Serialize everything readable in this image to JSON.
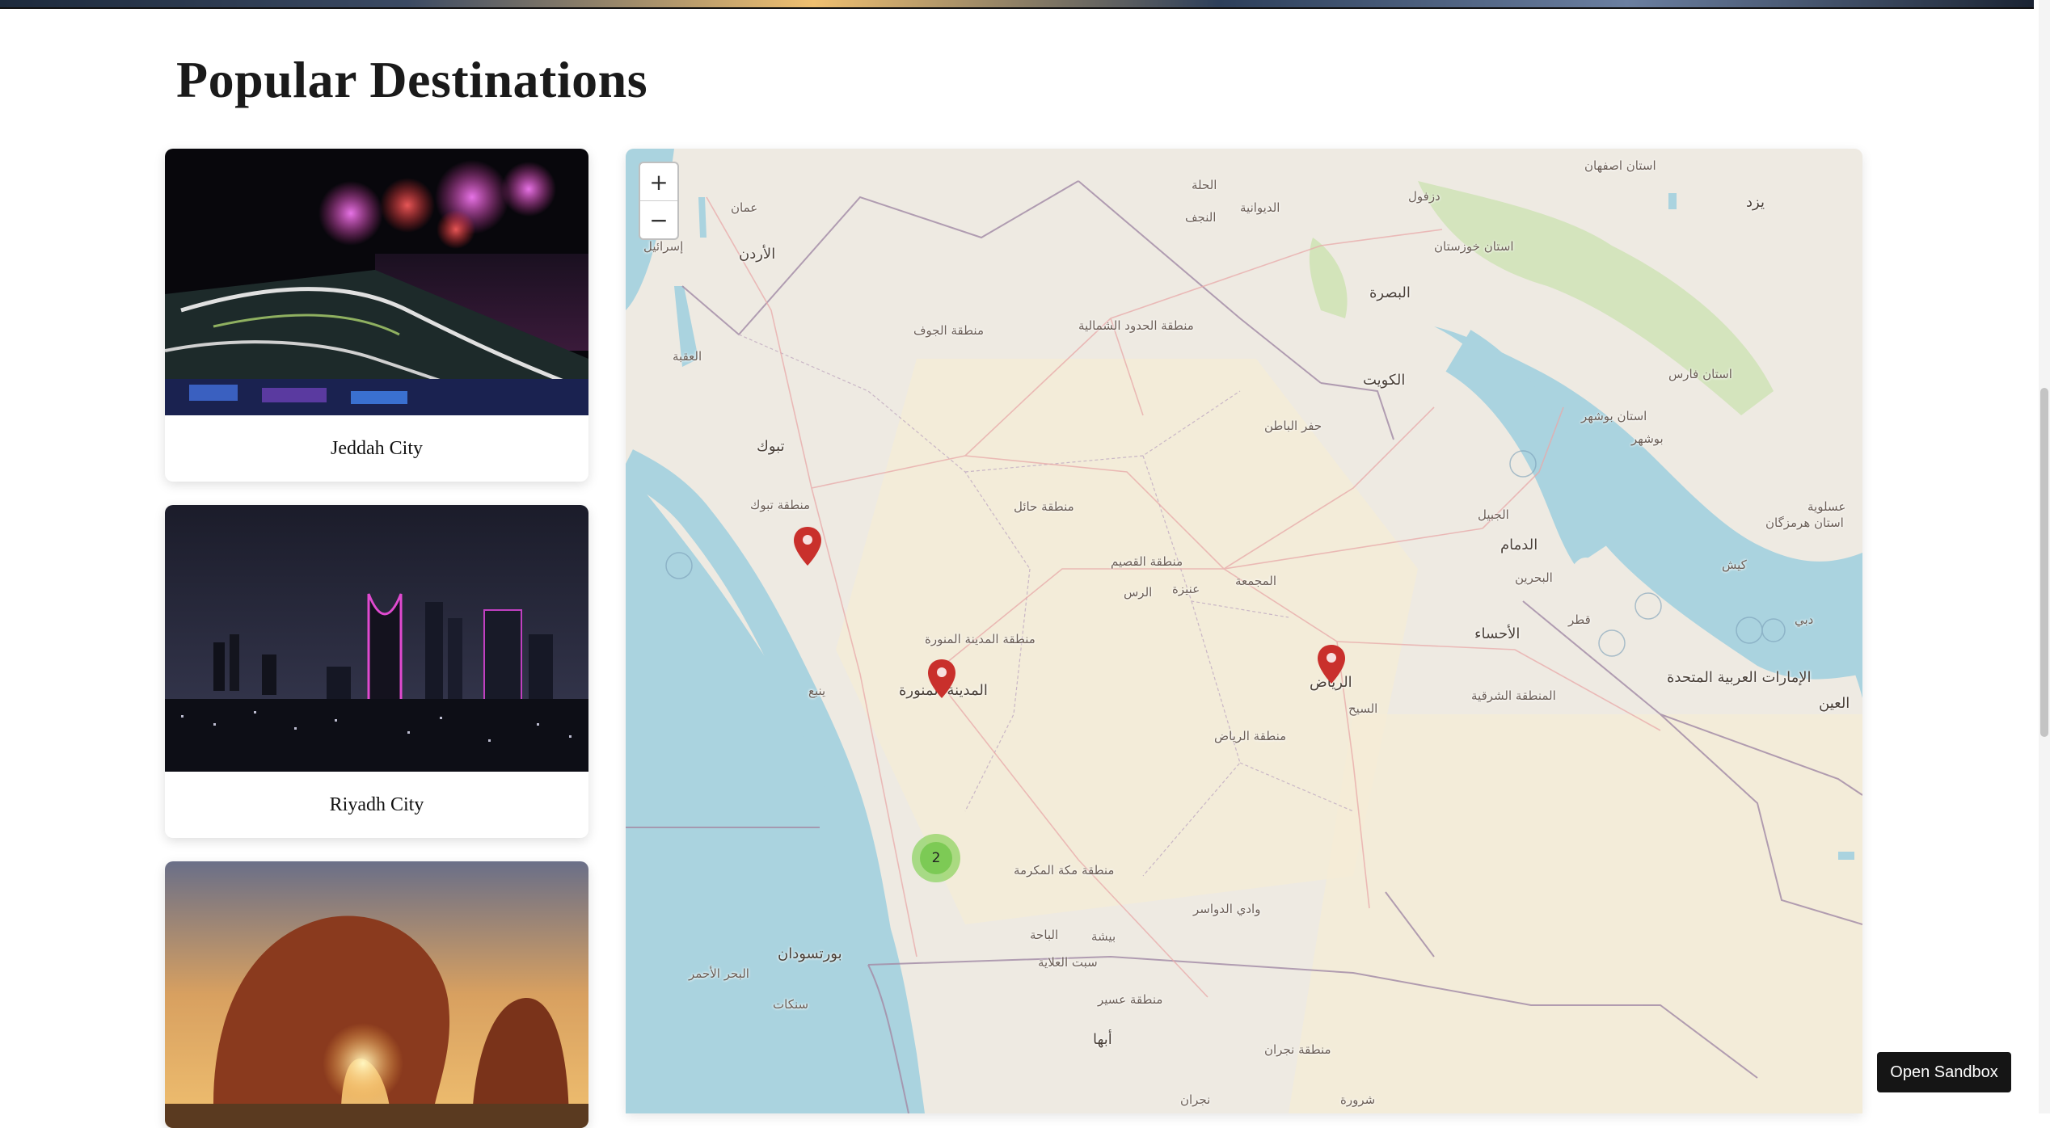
{
  "section": {
    "title": "Popular Destinations"
  },
  "cards": [
    {
      "caption": "Jeddah City"
    },
    {
      "caption": "Riyadh City"
    },
    {
      "caption": ""
    }
  ],
  "map": {
    "zoom_in": "+",
    "zoom_out": "−",
    "cluster_count": "2",
    "labels": [
      "عمان",
      "الأردن",
      "إسرائيل",
      "تبوك",
      "منطقة تبوك",
      "العقبة",
      "منطقة الجوف",
      "منطقة الحدود الشمالية",
      "حفر الباطن",
      "الكويت",
      "البصرة",
      "النجف",
      "الديوانية",
      "الحلة",
      "منطقة حائل",
      "منطقة القصيم",
      "عنيزة",
      "الرس",
      "المجمعة",
      "منطقة المدينة المنورة",
      "المدينة المنورة",
      "ينبع",
      "الرياض",
      "منطقة الرياض",
      "السيح",
      "الأحساء",
      "المنطقة الشرقية",
      "الدمام",
      "البحرين",
      "قطر",
      "الجبيل",
      "الإمارات العربية المتحدة",
      "دبي",
      "العين",
      "منطقة مكة المكرمة",
      "الباحة",
      "بيشة",
      "سبت العلاية",
      "وادي الدواسر",
      "منطقة عسير",
      "أبها",
      "نجران",
      "منطقة نجران",
      "شرورة",
      "بورتسودان",
      "البحر الأحمر",
      "سنكات",
      "استان فارس",
      "استان بوشهر",
      "بوشهر",
      "كيش",
      "عسلوية",
      "استان هرمزگان",
      "استان خوزستان",
      "استان اصفهان",
      "یزد",
      "دزفول"
    ]
  },
  "sandbox_button": "Open Sandbox",
  "colors": {
    "water": "#aad3df",
    "land": "#eeeae2",
    "marker": "#c9302c",
    "cluster": "#6ecc39"
  }
}
